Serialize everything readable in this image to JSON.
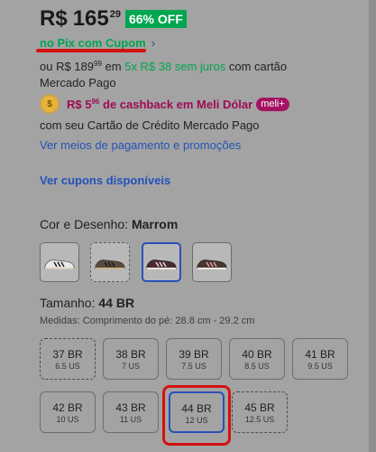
{
  "price": {
    "currency": "R$",
    "amount": "165",
    "cents": "29",
    "discount_badge": "66% OFF",
    "pix_text": "no Pix com Cupom",
    "chevron": "›"
  },
  "installments": {
    "prefix": "ou R$ 189",
    "prefix_cents": "99",
    "em": "em",
    "plan": "5x R$ 38 sem juros",
    "suffix": "com cartão",
    "line2": "Mercado Pago"
  },
  "cashback": {
    "text": "R$ 5",
    "text_cents": "96",
    "text_rest": "de cashback em Meli Dólar",
    "badge": "meli+",
    "line2": "com seu Cartão de Crédito Mercado Pago"
  },
  "links": {
    "payment": "Ver meios de pagamento e promoções",
    "coupons": "Ver cupons disponíveis"
  },
  "color": {
    "label": "Cor e Desenho:",
    "value": "Marrom",
    "swatches": [
      {
        "name": "white-black",
        "selected": false,
        "dashed": false
      },
      {
        "name": "brown-black",
        "selected": false,
        "dashed": true
      },
      {
        "name": "maroon",
        "selected": true,
        "dashed": false
      },
      {
        "name": "dark-brown-pink",
        "selected": false,
        "dashed": false
      }
    ]
  },
  "size": {
    "label": "Tamanho:",
    "value": "44 BR",
    "measure": "Medidas: Comprimento do pé: 28.8 cm - 29.2 cm",
    "options": [
      {
        "br": "37 BR",
        "us": "6.5 US",
        "state": "dashed"
      },
      {
        "br": "38 BR",
        "us": "7 US",
        "state": "normal"
      },
      {
        "br": "39 BR",
        "us": "7.5 US",
        "state": "normal"
      },
      {
        "br": "40 BR",
        "us": "8.5 US",
        "state": "normal"
      },
      {
        "br": "41 BR",
        "us": "9.5 US",
        "state": "normal"
      },
      {
        "br": "42 BR",
        "us": "10 US",
        "state": "normal"
      },
      {
        "br": "43 BR",
        "us": "11 US",
        "state": "normal"
      },
      {
        "br": "44 BR",
        "us": "12 US",
        "state": "selected"
      },
      {
        "br": "45 BR",
        "us": "12.5 US",
        "state": "dashed"
      }
    ]
  },
  "colors": {
    "green": "#00a650",
    "link": "#2352b8",
    "annotation_red": "#d3120f",
    "selected_border": "#2a50b8"
  }
}
